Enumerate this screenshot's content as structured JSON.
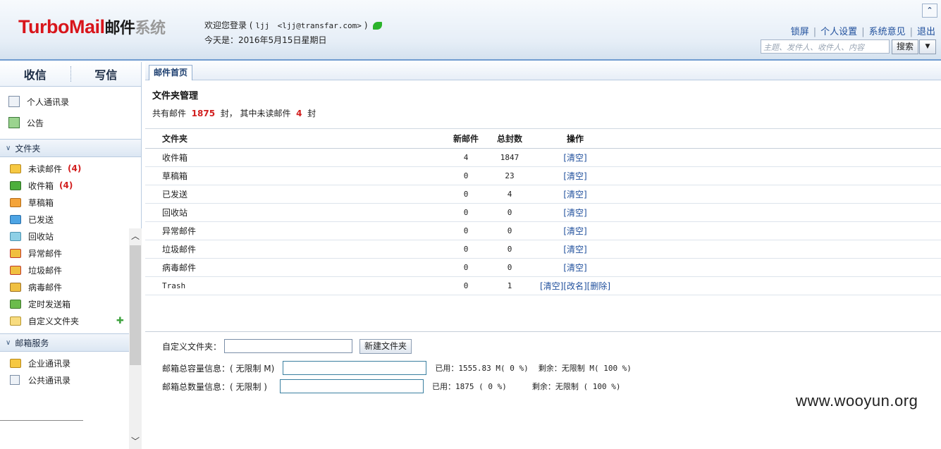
{
  "header": {
    "logo": {
      "part1": "TurboMail",
      "part2": "邮件",
      "part3": "系统"
    },
    "welcome_text": "欢迎您登录 (",
    "user": "ljj",
    "email": "<ljj@transfar.com>",
    "welcome_close": ")",
    "date_text": "今天是：2016年5月15日星期日",
    "links": [
      "锁屏",
      "个人设置",
      "系统意见",
      "退出"
    ],
    "search_placeholder": "主题、发件人、收件人、内容",
    "search_label": "搜索"
  },
  "sidebar": {
    "receive_label": "收信",
    "compose_label": "写信",
    "top_items": [
      "个人通讯录",
      "公告"
    ],
    "folders_section": "文件夹",
    "folders": [
      {
        "label": "未读邮件",
        "count": "(4)"
      },
      {
        "label": "收件箱",
        "count": "(4)"
      },
      {
        "label": "草稿箱",
        "count": ""
      },
      {
        "label": "已发送",
        "count": ""
      },
      {
        "label": "回收站",
        "count": ""
      },
      {
        "label": "异常邮件",
        "count": ""
      },
      {
        "label": "垃圾邮件",
        "count": ""
      },
      {
        "label": "病毒邮件",
        "count": ""
      },
      {
        "label": "定时发送箱",
        "count": ""
      },
      {
        "label": "自定义文件夹",
        "count": ""
      }
    ],
    "services_section": "邮箱服务",
    "services": [
      "企业通讯录",
      "公共通讯录"
    ]
  },
  "main": {
    "tab_label": "邮件首页",
    "title": "文件夹管理",
    "summary": {
      "prefix": "共有邮件",
      "total": "1875",
      "mid": "封，  其中未读邮件",
      "unread": "4",
      "suffix": "封"
    },
    "table": {
      "headers": {
        "folder": "文件夹",
        "new": "新邮件",
        "total": "总封数",
        "ops": "操作"
      },
      "rows": [
        {
          "name": "收件箱",
          "new": "4",
          "total": "1847",
          "ops": "[清空]"
        },
        {
          "name": "草稿箱",
          "new": "0",
          "total": "23",
          "ops": "[清空]"
        },
        {
          "name": "已发送",
          "new": "0",
          "total": "4",
          "ops": "[清空]"
        },
        {
          "name": "回收站",
          "new": "0",
          "total": "0",
          "ops": "[清空]"
        },
        {
          "name": "异常邮件",
          "new": "0",
          "total": "0",
          "ops": "[清空]"
        },
        {
          "name": "垃圾邮件",
          "new": "0",
          "total": "0",
          "ops": "[清空]"
        },
        {
          "name": "病毒邮件",
          "new": "0",
          "total": "0",
          "ops": "[清空]"
        },
        {
          "name": "Trash",
          "new": "0",
          "total": "1",
          "ops": "[清空][改名][删除]"
        }
      ]
    },
    "custom_folder_label": "自定义文件夹：",
    "new_folder_button": "新建文件夹",
    "capacity_label": "邮箱总容量信息：( 无限制 M)",
    "capacity_used": "已用：1555.83 M( 0 %)",
    "capacity_left": "剩余：无限制 M( 100 %)",
    "count_label": "邮箱总数量信息：( 无限制 )",
    "count_used": "已用：1875 ( 0 %)",
    "count_left": "剩余：无限制 ( 100 %)"
  },
  "watermark": "www.wooyun.org"
}
